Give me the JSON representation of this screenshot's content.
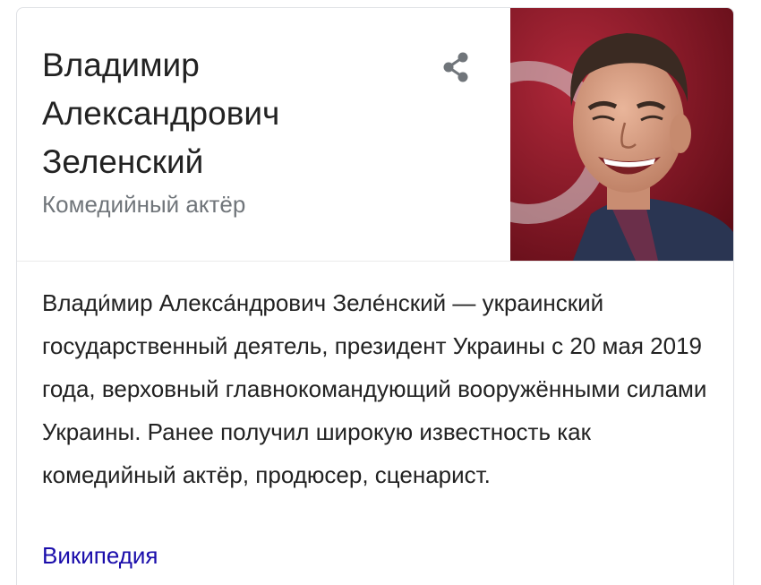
{
  "panel": {
    "title": "Владимир Александрович Зеленский",
    "subtitle": "Комедийный актёр",
    "description": "Влади́мир Алекса́ндрович Зеле́нский — украинский государственный деятель, президент Украины с 20 мая 2019 года, верховный главнокомандующий вооружёнными силами Украины. Ранее получил широкую известность как комедийный актёр, продюсер, сценарист.",
    "source_link": "Википедия"
  },
  "icons": {
    "share": "share-icon"
  },
  "colors": {
    "title_text": "#222222",
    "subtitle_text": "#70757a",
    "link": "#1a0dab",
    "icon": "#70757a",
    "photo_background": "#8a1522"
  }
}
